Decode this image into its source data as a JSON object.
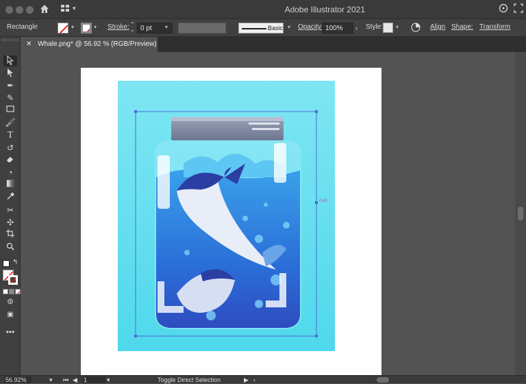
{
  "window": {
    "title": "Adobe Illustrator 2021"
  },
  "control_bar": {
    "selection_type": "Rectangle",
    "stroke_label": "Stroke:",
    "stroke_weight": "0 pt",
    "brush": "Basic",
    "opacity_label": "Opacity:",
    "opacity_value": "100%",
    "style_label": "Style:",
    "align_label": "Align",
    "shape_label": "Shape:",
    "transform_label": "Transform"
  },
  "document_tab": {
    "label": "Whale.png* @ 56.92 % (RGB/Preview)"
  },
  "canvas": {
    "path_label": "Path"
  },
  "status_bar": {
    "zoom": "56.92%",
    "artboard": "1",
    "status_text": "Toggle Direct Selection"
  },
  "colors": {
    "ui_dark": "#404040",
    "canvas_bg": "#535353",
    "selection": "#4a6cd4",
    "art_bg": "#5fdcef",
    "red_slash": "#e02020"
  },
  "icons": [
    "home-icon",
    "workspace-icon",
    "selection-tool-icon",
    "direct-selection-tool-icon",
    "pen-tool-icon",
    "curvature-tool-icon",
    "rectangle-tool-icon",
    "paintbrush-tool-icon",
    "type-tool-icon",
    "rotate-tool-icon",
    "eraser-tool-icon",
    "shape-builder-tool-icon",
    "gradient-tool-icon",
    "eyedropper-tool-icon",
    "blend-tool-icon",
    "symbol-sprayer-tool-icon",
    "artboard-tool-icon",
    "zoom-tool-icon"
  ]
}
